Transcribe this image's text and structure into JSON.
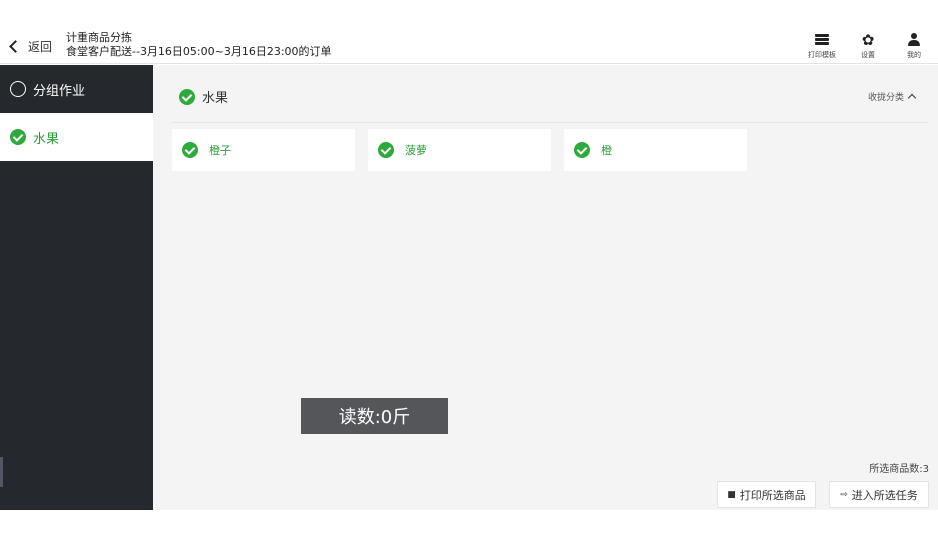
{
  "header": {
    "back_label": "返回",
    "title": "计重商品分拣",
    "subtitle": "食堂客户配送--3月16日05:00~3月16日23:00的订单",
    "tools": [
      {
        "label": "打印模板",
        "icon": "printer-icon"
      },
      {
        "label": "设置",
        "icon": "gear-icon"
      },
      {
        "label": "我的",
        "icon": "user-icon"
      }
    ]
  },
  "sidebar": {
    "items": [
      {
        "label": "分组作业",
        "icon": "circle-icon",
        "active": false
      },
      {
        "label": "水果",
        "icon": "check-circle-icon",
        "active": true
      }
    ]
  },
  "main": {
    "group_title": "水果",
    "collapse_label": "收拢分类",
    "products": [
      {
        "name": "橙子"
      },
      {
        "name": "菠萝"
      },
      {
        "name": "橙"
      }
    ],
    "reading": "读数:0斤",
    "selected_count": "所选商品数:3",
    "print_button": "打印所选商品",
    "enter_button": "进入所选任务"
  },
  "colors": {
    "accent_green": "#2eaa3c",
    "sidebar_bg": "#25282c",
    "main_bg": "#f4f4f4"
  }
}
